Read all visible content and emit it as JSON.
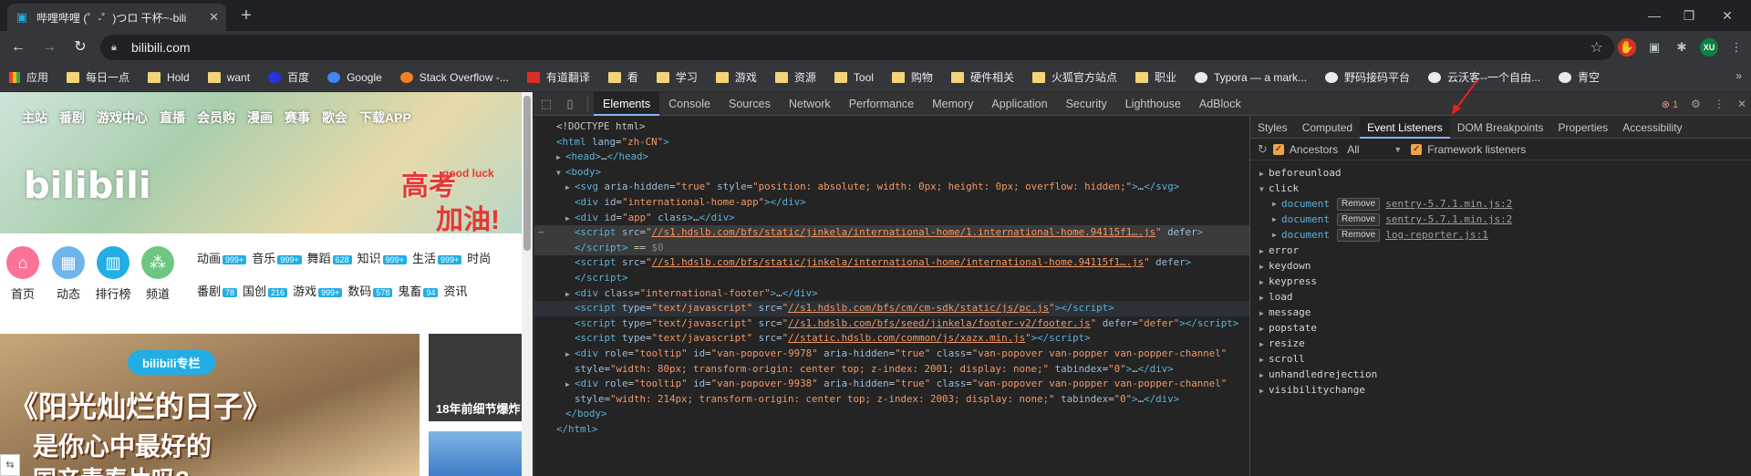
{
  "browser": {
    "tab_title": "哔哩哔哩 (゜-゜)つロ 干杯~-bili",
    "url": "bilibili.com",
    "profile_initials": "XU"
  },
  "bookmarks": [
    "应用",
    "每日一点",
    "Hold",
    "want",
    "百度",
    "Google",
    "Stack Overflow -...",
    "有道翻译",
    "看",
    "学习",
    "游戏",
    "资源",
    "Tool",
    "购物",
    "硬件相关",
    "火狐官方站点",
    "职业",
    "Typora — a mark...",
    "野码接码平台",
    "云沃客--一个自由...",
    "青空"
  ],
  "site": {
    "nav": [
      "主站",
      "番剧",
      "游戏中心",
      "直播",
      "会员购",
      "漫画",
      "赛事",
      "歌会",
      "下载APP"
    ],
    "logo": "bilibili",
    "promo_1": "高考",
    "promo_2": "good luck",
    "promo_3": "加油!",
    "cats": [
      "首页",
      "动态",
      "排行榜",
      "频道"
    ],
    "zones_row1": [
      {
        "name": "动画",
        "count": "999+"
      },
      {
        "name": "音乐",
        "count": "999+"
      },
      {
        "name": "舞蹈",
        "count": "628"
      },
      {
        "name": "知识",
        "count": "999+"
      },
      {
        "name": "生活",
        "count": "999+"
      },
      {
        "name": "时尚",
        "count": ""
      }
    ],
    "zones_row2": [
      {
        "name": "番剧",
        "count": "78"
      },
      {
        "name": "国创",
        "count": "216"
      },
      {
        "name": "游戏",
        "count": "999+"
      },
      {
        "name": "数码",
        "count": "578"
      },
      {
        "name": "鬼畜",
        "count": "94"
      },
      {
        "name": "资讯",
        "count": ""
      }
    ],
    "movie_tag": "bilibili专栏",
    "movie_line1": "《阳光灿烂的日子》",
    "movie_line2": "是你心中最好的",
    "movie_line3": "国产青春片吗?",
    "side_caption": "18年前细节爆炸"
  },
  "devtools": {
    "tabs": [
      "Elements",
      "Console",
      "Sources",
      "Network",
      "Performance",
      "Memory",
      "Application",
      "Security",
      "Lighthouse",
      "AdBlock"
    ],
    "active_tab": "Elements",
    "error_count": "1",
    "sidebar_tabs": [
      "Styles",
      "Computed",
      "Event Listeners",
      "DOM Breakpoints",
      "Properties",
      "Accessibility"
    ],
    "ancestors_label": "Ancestors",
    "ancestors_select": "All",
    "framework_label": "Framework listeners",
    "events": [
      "beforeunload",
      "click",
      "error",
      "keydown",
      "keypress",
      "load",
      "message",
      "popstate",
      "resize",
      "scroll",
      "unhandledrejection",
      "visibilitychange"
    ],
    "click_listeners": [
      {
        "target": "document",
        "remove": "Remove",
        "source": "sentry-5.7.1.min.js:2"
      },
      {
        "target": "document",
        "remove": "Remove",
        "source": "sentry-5.7.1.min.js:2"
      },
      {
        "target": "document",
        "remove": "Remove",
        "source": "log-reporter.js:1"
      }
    ],
    "dom_lines": [
      {
        "tri": "",
        "pre": "",
        "html": "&lt;!DOCTYPE html&gt;"
      },
      {
        "tri": "",
        "pre": "",
        "html": "<span class=\"tg\">&lt;html</span> <span class=\"at\">lang</span>=<span class=\"av\">\"zh-CN\"</span><span class=\"tg\">&gt;</span>"
      },
      {
        "tri": "▶",
        "pre": "  ",
        "html": "<span class=\"tg\">&lt;head&gt;</span>…<span class=\"tg\">&lt;/head&gt;</span>"
      },
      {
        "tri": "▼",
        "pre": "  ",
        "html": "<span class=\"tg\">&lt;body&gt;</span>"
      },
      {
        "tri": "▶",
        "pre": "    ",
        "html": "<span class=\"tg\">&lt;svg</span> <span class=\"at\">aria-hidden</span>=<span class=\"av\">\"true\"</span> <span class=\"at\">style</span>=<span class=\"av\">\"position: absolute; width: 0px; height: 0px; overflow: hidden;\"</span><span class=\"tg\">&gt;</span>…<span class=\"tg\">&lt;/svg&gt;</span>"
      },
      {
        "tri": "",
        "pre": "    ",
        "html": "<span class=\"tg\">&lt;div</span> <span class=\"at\">id</span>=<span class=\"av\">\"international-home-app\"</span><span class=\"tg\">&gt;&lt;/div&gt;</span>"
      },
      {
        "tri": "▶",
        "pre": "    ",
        "html": "<span class=\"tg\">&lt;div</span> <span class=\"at\">id</span>=<span class=\"av\">\"app\"</span> <span class=\"at\">class</span><span class=\"tg\">&gt;</span>…<span class=\"tg\">&lt;/div&gt;</span>"
      },
      {
        "tri": "",
        "pre": "    ",
        "cls": "sel",
        "html": "<span class=\"tg\">&lt;script</span> <span class=\"at\">src</span>=<span class=\"av\">\"</span><span class=\"lk\">//s1.hdslb.com/bfs/static/jinkela/international-home/1.international-home.94115f1….js</span><span class=\"av\">\"</span> <span class=\"at\">defer</span><span class=\"tg\">&gt;</span>"
      },
      {
        "tri": "",
        "pre": "    ",
        "cls": "sel",
        "html": "<span class=\"tg\">&lt;/script&gt;</span> == <span class=\"cm\">$0</span>"
      },
      {
        "tri": "",
        "pre": "    ",
        "html": "<span class=\"tg\">&lt;script</span> <span class=\"at\">src</span>=<span class=\"av\">\"</span><span class=\"lk\">//s1.hdslb.com/bfs/static/jinkela/international-home/international-home.94115f1….js</span><span class=\"av\">\"</span> <span class=\"at\">defer</span><span class=\"tg\">&gt;</span>"
      },
      {
        "tri": "",
        "pre": "    ",
        "html": "<span class=\"tg\">&lt;/script&gt;</span>"
      },
      {
        "tri": "▶",
        "pre": "    ",
        "html": "<span class=\"tg\">&lt;div</span> <span class=\"at\">class</span>=<span class=\"av\">\"international-footer\"</span><span class=\"tg\">&gt;</span>…<span class=\"tg\">&lt;/div&gt;</span>"
      },
      {
        "tri": "",
        "pre": "    ",
        "cls": "hov",
        "html": "<span class=\"tg\">&lt;script</span> <span class=\"at\">type</span>=<span class=\"av\">\"text/javascript\"</span> <span class=\"at\">src</span>=<span class=\"av\">\"</span><span class=\"lk\">//s1.hdslb.com/bfs/cm/cm-sdk/static/js/pc.js</span><span class=\"av\">\"</span><span class=\"tg\">&gt;&lt;/script&gt;</span>"
      },
      {
        "tri": "",
        "pre": "    ",
        "html": "<span class=\"tg\">&lt;script</span> <span class=\"at\">type</span>=<span class=\"av\">\"text/javascript\"</span> <span class=\"at\">src</span>=<span class=\"av\">\"</span><span class=\"lk\">//s1.hdslb.com/bfs/seed/jinkela/footer-v2/footer.js</span><span class=\"av\">\"</span> <span class=\"at\">defer</span>=<span class=\"av\">\"defer\"</span><span class=\"tg\">&gt;&lt;/script&gt;</span>"
      },
      {
        "tri": "",
        "pre": "    ",
        "html": "<span class=\"tg\">&lt;script</span> <span class=\"at\">type</span>=<span class=\"av\">\"text/javascript\"</span> <span class=\"at\">src</span>=<span class=\"av\">\"</span><span class=\"lk\">//static.hdslb.com/common/js/xazx.min.js</span><span class=\"av\">\"</span><span class=\"tg\">&gt;&lt;/script&gt;</span>"
      },
      {
        "tri": "▶",
        "pre": "    ",
        "html": "<span class=\"tg\">&lt;div</span> <span class=\"at\">role</span>=<span class=\"av\">\"tooltip\"</span> <span class=\"at\">id</span>=<span class=\"av\">\"van-popover-9978\"</span> <span class=\"at\">aria-hidden</span>=<span class=\"av\">\"true\"</span> <span class=\"at\">class</span>=<span class=\"av\">\"van-popover van-popper van-popper-channel\"</span>"
      },
      {
        "tri": "",
        "pre": "    ",
        "html": "<span class=\"at\">style</span>=<span class=\"av\">\"width: 80px; transform-origin: center top; z-index: 2001; display: none;\"</span> <span class=\"at\">tabindex</span>=<span class=\"av\">\"0\"</span><span class=\"tg\">&gt;</span>…<span class=\"tg\">&lt;/div&gt;</span>"
      },
      {
        "tri": "▶",
        "pre": "    ",
        "html": "<span class=\"tg\">&lt;div</span> <span class=\"at\">role</span>=<span class=\"av\">\"tooltip\"</span> <span class=\"at\">id</span>=<span class=\"av\">\"van-popover-9938\"</span> <span class=\"at\">aria-hidden</span>=<span class=\"av\">\"true\"</span> <span class=\"at\">class</span>=<span class=\"av\">\"van-popover van-popper van-popper-channel\"</span>"
      },
      {
        "tri": "",
        "pre": "    ",
        "html": "<span class=\"at\">style</span>=<span class=\"av\">\"width: 214px; transform-origin: center top; z-index: 2003; display: none;\"</span> <span class=\"at\">tabindex</span>=<span class=\"av\">\"0\"</span><span class=\"tg\">&gt;</span>…<span class=\"tg\">&lt;/div&gt;</span>"
      },
      {
        "tri": "",
        "pre": "  ",
        "html": "<span class=\"tg\">&lt;/body&gt;</span>"
      },
      {
        "tri": "",
        "pre": "",
        "html": "<span class=\"tg\">&lt;/html&gt;</span>"
      }
    ]
  },
  "colors": {
    "accent": "#8ab4f8",
    "bili_blue": "#23ade5",
    "bili_pink": "#fb7299",
    "checkbox": "#f0a24c"
  }
}
